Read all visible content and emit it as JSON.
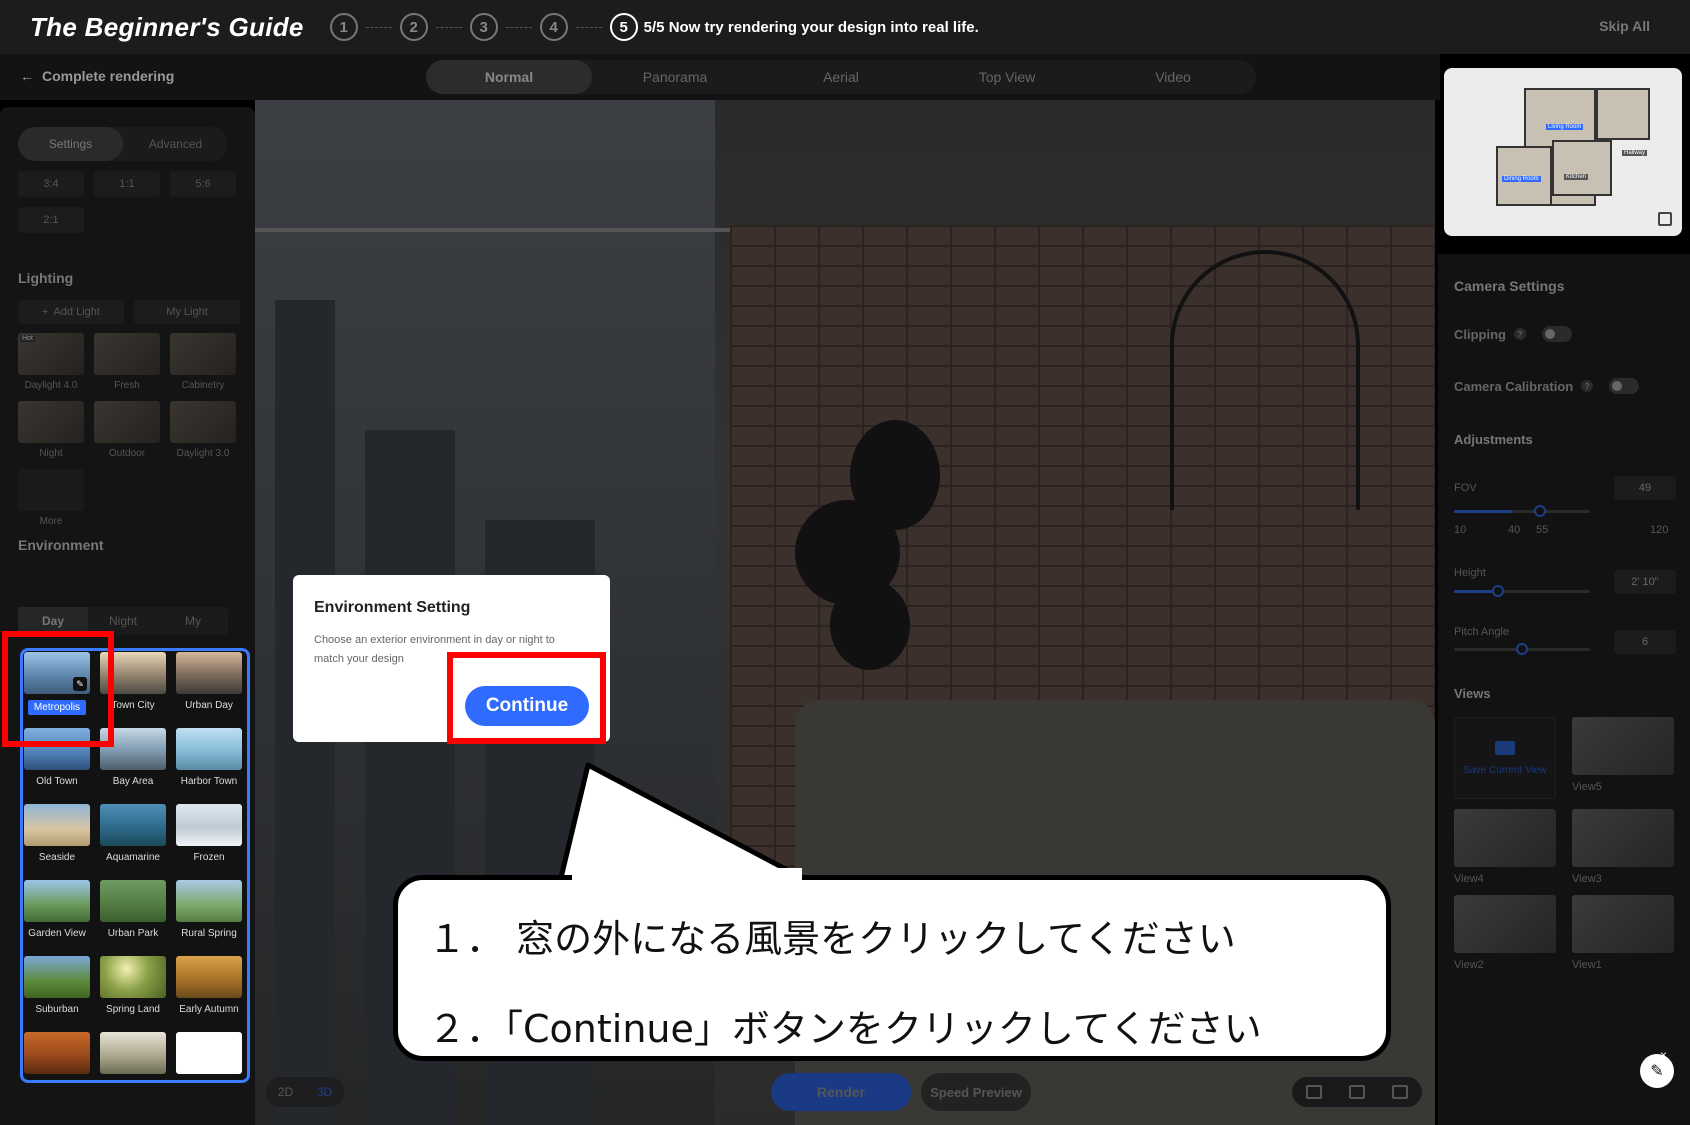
{
  "guide": {
    "title": "The Beginner's Guide",
    "steps": [
      "1",
      "2",
      "3",
      "4",
      "5"
    ],
    "step_text": "5/5 Now try rendering your design into real life.",
    "skip": "Skip All"
  },
  "header": {
    "back_label": "Complete rendering",
    "modes": [
      "Normal",
      "Panorama",
      "Aerial",
      "Top View",
      "Video"
    ],
    "active_mode": "Normal"
  },
  "left_panel": {
    "tabs": [
      "Settings",
      "Advanced"
    ],
    "ratios": [
      "3:4",
      "1:1",
      "5:6",
      "2:1"
    ],
    "lighting_title": "Lighting",
    "add_light": "Add Light",
    "my_light": "My Light",
    "hot_badge": "Hot",
    "lighting_presets": [
      "Daylight 4.0",
      "Fresh",
      "Cabinetry",
      "Night",
      "Outdoor",
      "Daylight 3.0",
      "More"
    ],
    "environment_title": "Environment",
    "env_tabs": [
      "Day",
      "Night",
      "My"
    ],
    "environments": [
      "Metropolis",
      "Town City",
      "Urban Day",
      "Old Town",
      "Bay Area",
      "Harbor Town",
      "Seaside",
      "Aquamarine",
      "Frozen",
      "Garden View",
      "Urban Park",
      "Rural Spring",
      "Suburban",
      "Spring Land",
      "Early Autumn",
      "",
      "",
      ""
    ],
    "selected_environment": "Metropolis"
  },
  "minimap": {
    "labels": [
      "Living Room",
      "Hallway",
      "Dining Room",
      "Kitchen"
    ]
  },
  "right_panel": {
    "camera_settings": "Camera Settings",
    "clipping": "Clipping",
    "camera_calibration": "Camera Calibration",
    "adjustments": "Adjustments",
    "fov_label": "FOV",
    "fov_value": "49",
    "fov_ticks": [
      "10",
      "40",
      "55",
      "120"
    ],
    "height_label": "Height",
    "height_value": "2' 10\"",
    "pitch_label": "Pitch Angle",
    "pitch_value": "6",
    "views_title": "Views",
    "save_view": "Save Current View",
    "views": [
      "View5",
      "View4",
      "View3",
      "View2",
      "View1"
    ]
  },
  "bottom": {
    "d2": "2D",
    "d3": "3D",
    "render": "Render",
    "speed_preview": "Speed Preview"
  },
  "dialog": {
    "title": "Environment Setting",
    "description": "Choose an exterior environment in day or night to match your design",
    "continue": "Continue"
  },
  "callout": {
    "line1": "１．  窓の外になる風景をクリックしてください",
    "line2": "２．「Continue」ボタンをクリックしてください"
  },
  "colors": {
    "accent": "#2f6bff",
    "highlight_red": "#ff0000",
    "selection_border": "#3b7bff"
  }
}
